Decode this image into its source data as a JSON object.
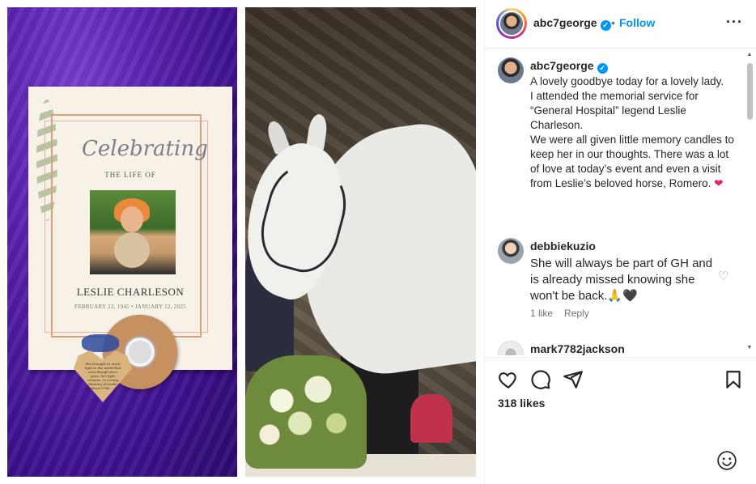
{
  "post": {
    "username": "abc7george",
    "dot": "•",
    "follow_label": "Follow",
    "more_label": "···",
    "caption": "A lovely goodbye today for a lovely lady.\nI attended the memorial service for “General Hospital” legend Leslie Charleson.\nWe were all given little memory candles to keep her in our thoughts.  There was a lot of love at today’s event and even a visit from Leslie’s beloved horse, Romero.",
    "caption_heart": "❤",
    "likes": "318 likes"
  },
  "program_card": {
    "celebrating": "Celebrating",
    "the_life_of": "THE LIFE OF",
    "name": "LESLIE CHARLESON",
    "dates": "FEBRUARY 22, 1945 • JANUARY 12, 2025",
    "heart_tag": "She brought so much light to the world that even though she's gone, her light remains. In Loving Memory of Leslie Charleson 1945 – 2025"
  },
  "comments": [
    {
      "username": "debbiekuzio",
      "text": "She will always be part of GH and is already missed knowing she won't be back.🙏🖤",
      "likes_label": "1 like",
      "reply_label": "Reply"
    },
    {
      "username": "mark7782jackson"
    }
  ],
  "icons": {
    "verified": "✓",
    "comment_like": "♡",
    "scroll_up": "▲",
    "scroll_down": "▼"
  },
  "colors": {
    "accent": "#0095f6",
    "text": "#262626",
    "muted": "#737373"
  }
}
